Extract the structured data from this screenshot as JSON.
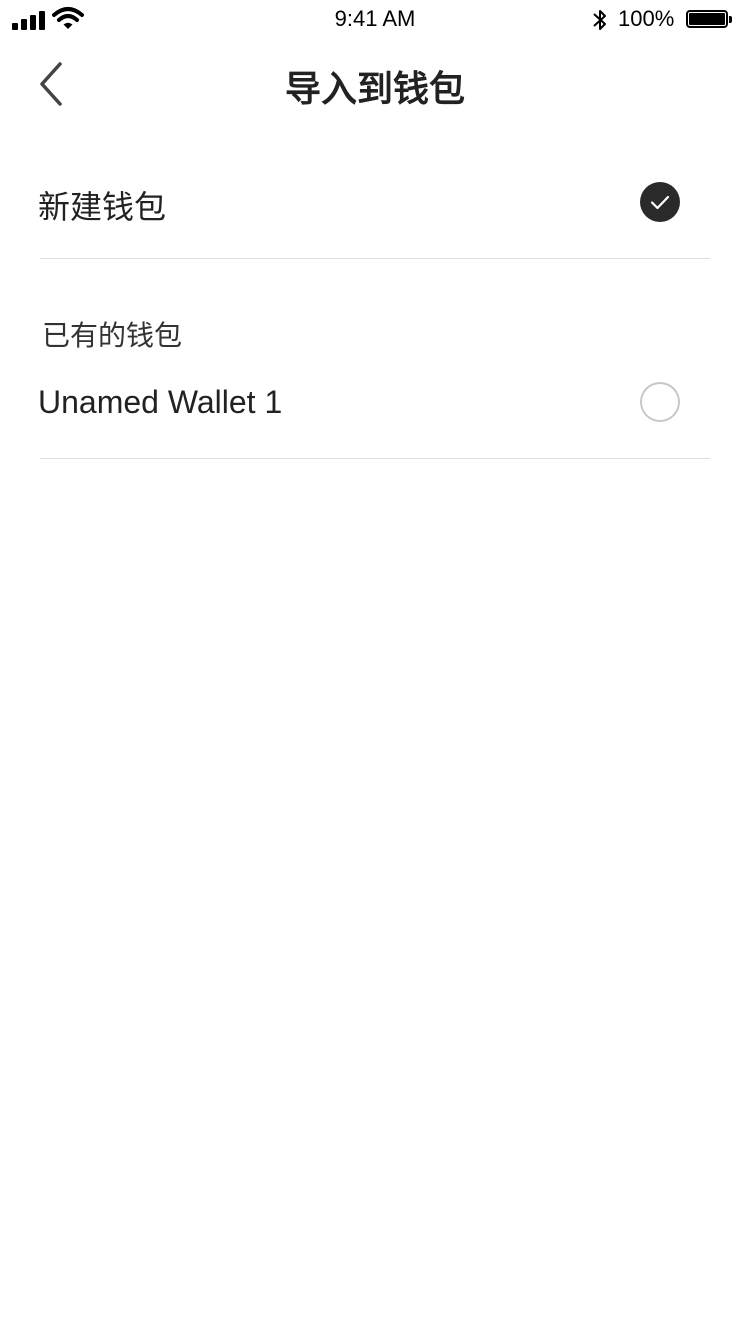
{
  "status_bar": {
    "time": "9:41 AM",
    "battery_percent": "100%",
    "icons": [
      "signal-icon",
      "wifi-icon",
      "bluetooth-icon",
      "battery-icon"
    ]
  },
  "nav": {
    "title": "导入到钱包",
    "back_icon": "chevron-left-icon"
  },
  "new_wallet": {
    "label": "新建钱包",
    "selected": true
  },
  "existing_section": {
    "title": "已有的钱包",
    "wallets": [
      {
        "label": "Unamed Wallet 1",
        "selected": false
      }
    ]
  },
  "colors": {
    "checked": "#2a2a2a",
    "divider": "#dcdcdc",
    "text": "#222222"
  }
}
